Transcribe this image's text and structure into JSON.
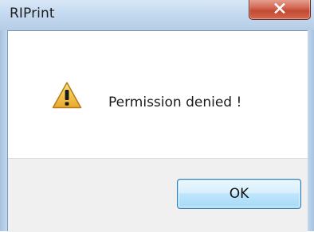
{
  "window": {
    "title": "RIPrint",
    "close_label": "x"
  },
  "dialog": {
    "icon": "warning-icon",
    "message": "Permission denied !",
    "ok_label": "OK"
  },
  "colors": {
    "titlebar": "#c5daf0",
    "close_button": "#c24a34",
    "button_border": "#3c7fb1",
    "warning_yellow": "#f2c12e"
  }
}
